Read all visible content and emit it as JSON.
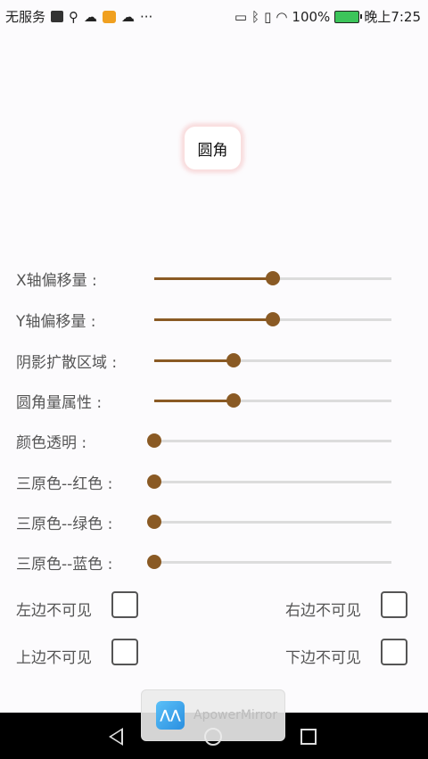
{
  "status_bar": {
    "carrier": "无服务",
    "left_icons": [
      "apowermirror-icon",
      "usb-icon",
      "cloud-icon",
      "weibo-icon",
      "cloud-upload-icon",
      "more-icon"
    ],
    "overflow": "···",
    "right_icons": [
      "cast-icon",
      "bluetooth-icon",
      "vibrate-icon",
      "wifi-icon"
    ],
    "battery_percent": "100%",
    "time": "晚上7:25"
  },
  "demo_box": {
    "label": "圆角",
    "shadow_color": "#f08c8c"
  },
  "sliders": [
    {
      "label": "X轴偏移量 :",
      "value": 0.5
    },
    {
      "label": "Y轴偏移量 :",
      "value": 0.5
    },
    {
      "label": "阴影扩散区域 :",
      "value": 0.335
    },
    {
      "label": "圆角量属性 :",
      "value": 0.335
    },
    {
      "label": "颜色透明 :",
      "value": 0
    },
    {
      "label": "三原色--红色 :",
      "value": 0
    },
    {
      "label": "三原色--绿色 :",
      "value": 0
    },
    {
      "label": "三原色--蓝色 :",
      "value": 0
    }
  ],
  "checkboxes": {
    "left_hidden": {
      "label": "左边不可见",
      "checked": false
    },
    "right_hidden": {
      "label": "右边不可见",
      "checked": false
    },
    "top_hidden": {
      "label": "上边不可见",
      "checked": false
    },
    "bottom_hidden": {
      "label": "下边不可见",
      "checked": false
    }
  },
  "overlay": {
    "app_name": "ApowerMirror"
  },
  "colors": {
    "accent": "#8a5a24",
    "track": "#dcdcdc"
  }
}
